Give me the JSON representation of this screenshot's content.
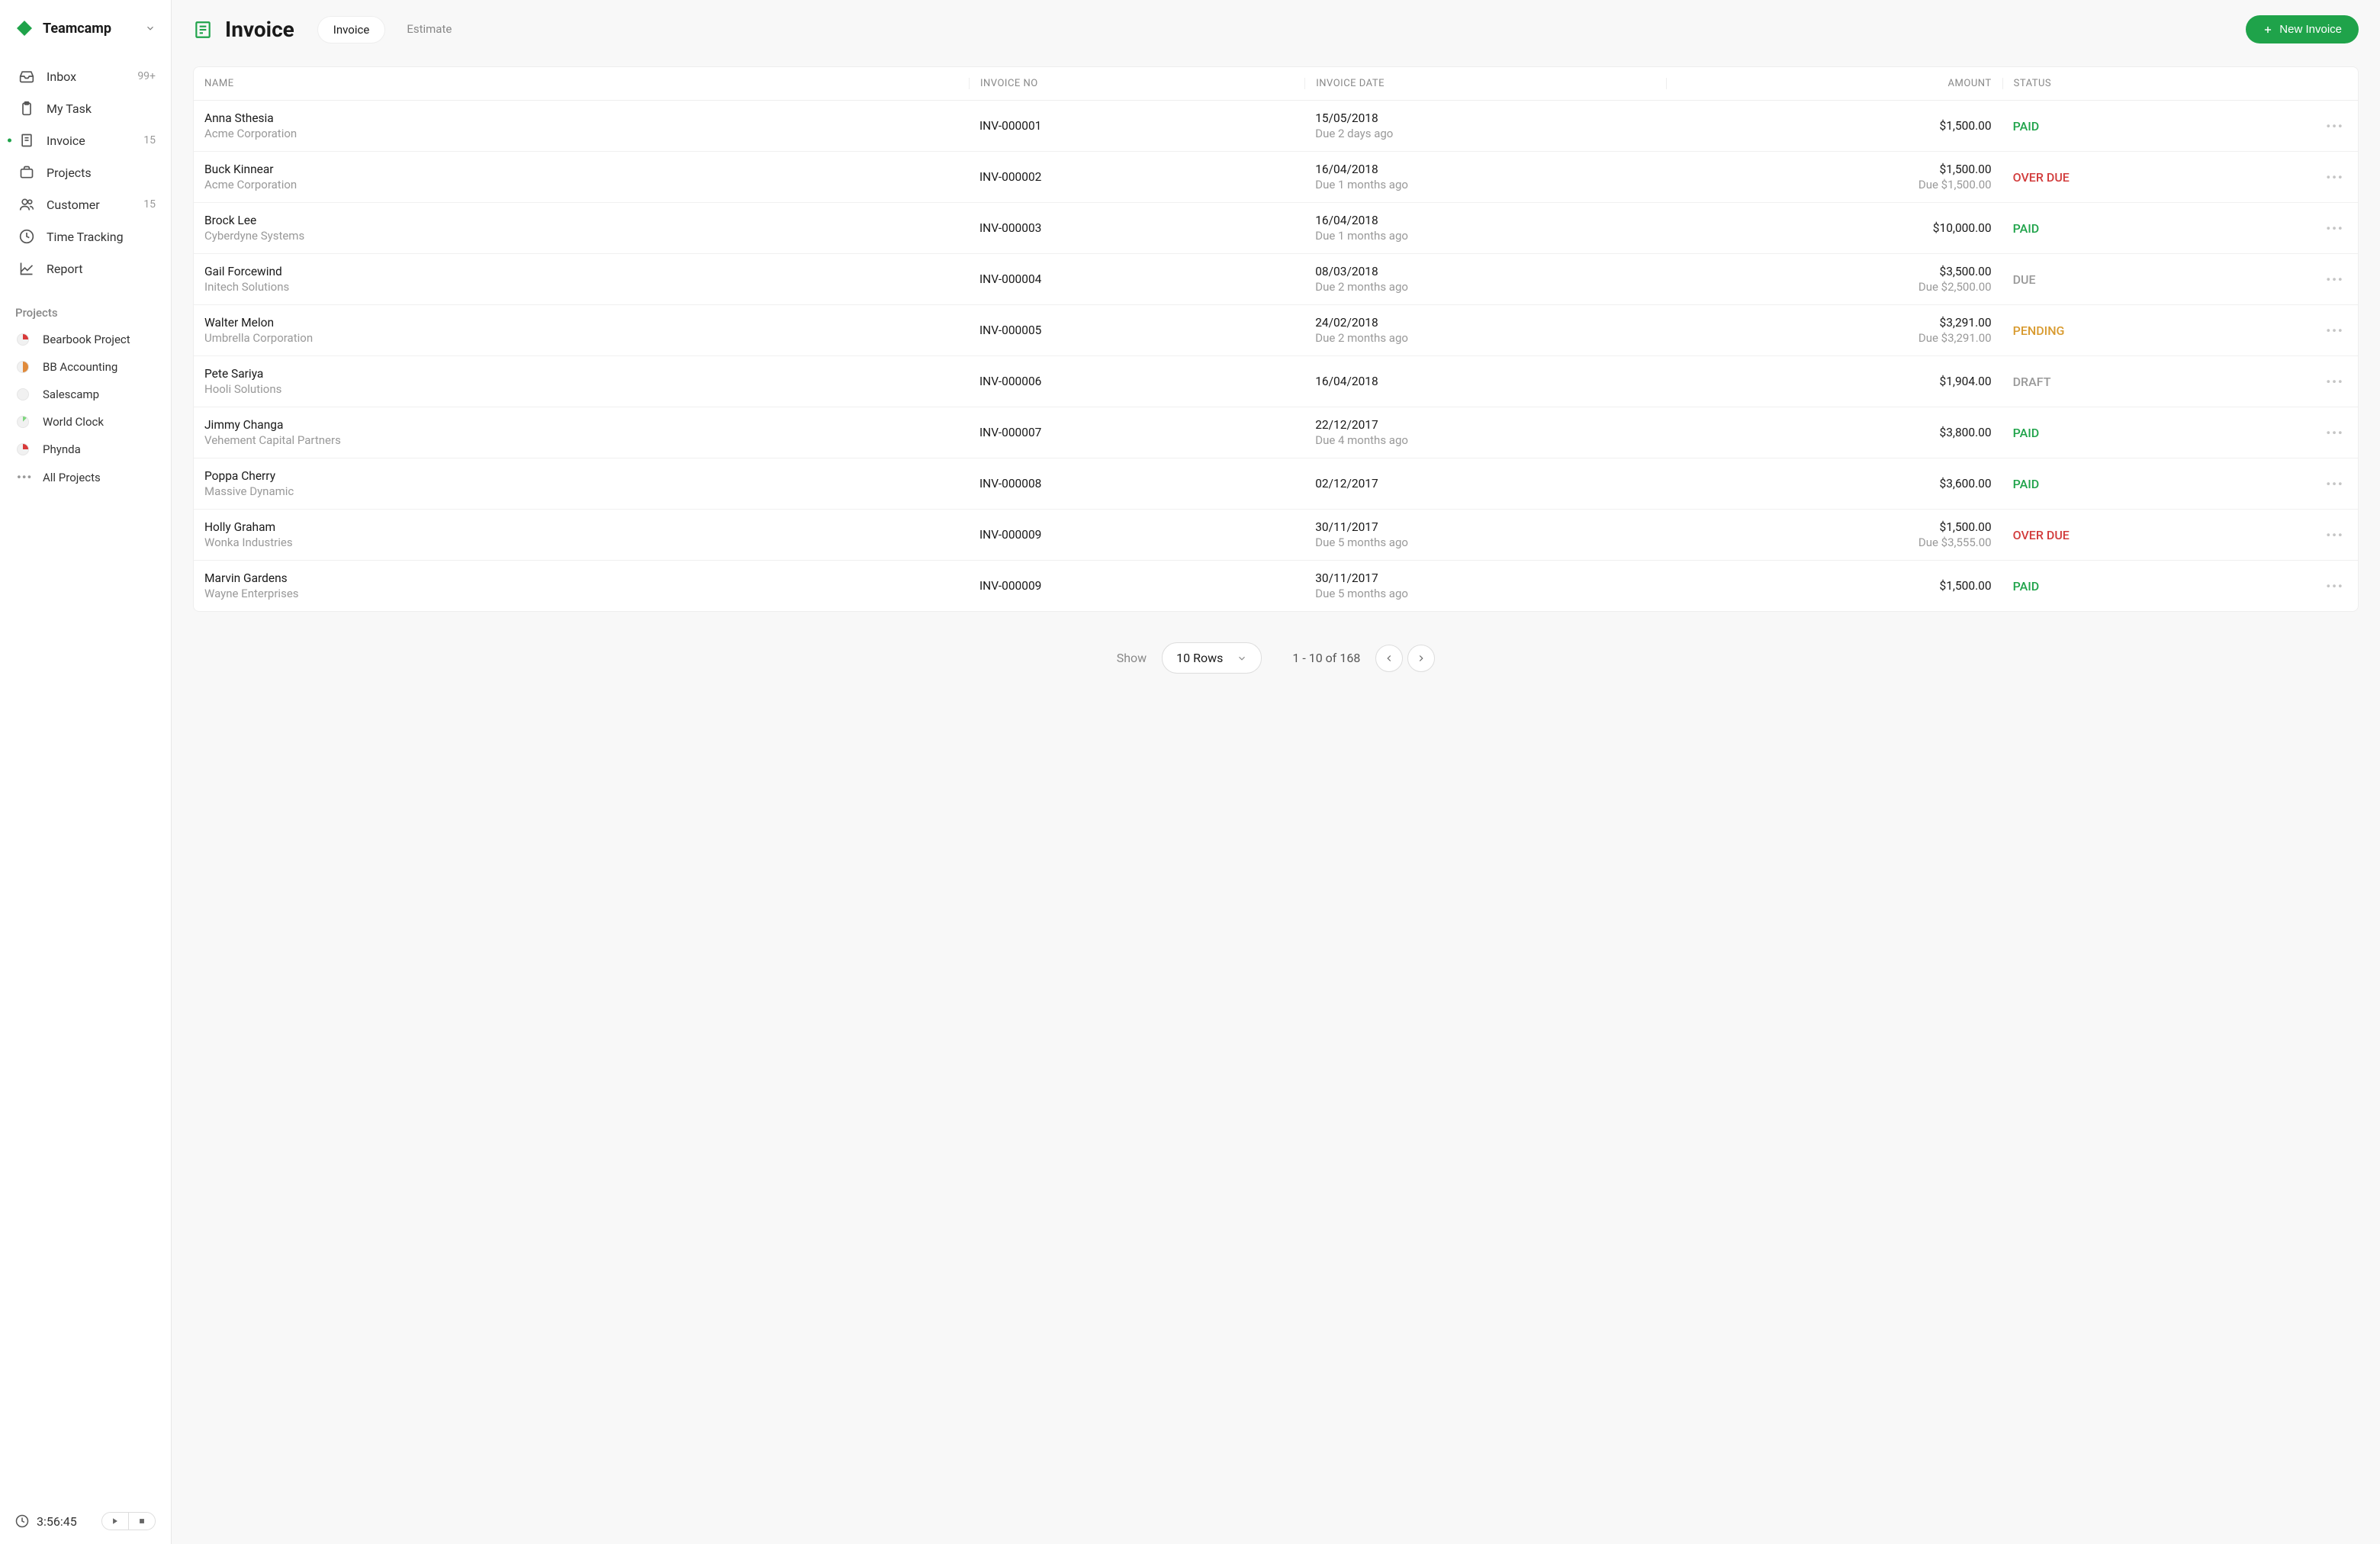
{
  "brand": {
    "name": "Teamcamp"
  },
  "nav": [
    {
      "label": "Inbox",
      "badge": "99+",
      "icon": "inbox"
    },
    {
      "label": "My Task",
      "badge": "",
      "icon": "clipboard"
    },
    {
      "label": "Invoice",
      "badge": "15",
      "icon": "file",
      "active": true
    },
    {
      "label": "Projects",
      "badge": "",
      "icon": "briefcase"
    },
    {
      "label": "Customer",
      "badge": "15",
      "icon": "users"
    },
    {
      "label": "Time Tracking",
      "badge": "",
      "icon": "clock"
    },
    {
      "label": "Report",
      "badge": "",
      "icon": "chart"
    }
  ],
  "projects_section": "Projects",
  "projects": [
    {
      "label": "Bearbook Project",
      "color": "#d83a3a",
      "pct": 25
    },
    {
      "label": "BB Accounting",
      "color": "#e08a3a",
      "pct": 50
    },
    {
      "label": "Salescamp",
      "color": "#dedede",
      "pct": 0
    },
    {
      "label": "World Clock",
      "color": "#7ed67e",
      "pct": 12
    },
    {
      "label": "Phynda",
      "color": "#d83a3a",
      "pct": 25
    }
  ],
  "all_projects": "All Projects",
  "timer": {
    "value": "3:56:45"
  },
  "page": {
    "title": "Invoice"
  },
  "tabs": [
    {
      "label": "Invoice",
      "active": true
    },
    {
      "label": "Estimate",
      "active": false
    }
  ],
  "new_button": "New Invoice",
  "columns": {
    "name": "NAME",
    "no": "INVOICE NO",
    "date": "INVOICE DATE",
    "amount": "AMOUNT",
    "status": "STATUS"
  },
  "rows": [
    {
      "name": "Anna Sthesia",
      "company": "Acme Corporation",
      "no": "INV-000001",
      "date": "15/05/2018",
      "due": "Due 2 days ago",
      "amount": "$1,500.00",
      "amount_sub": "",
      "status": "PAID"
    },
    {
      "name": "Buck Kinnear",
      "company": "Acme Corporation",
      "no": "INV-000002",
      "date": "16/04/2018",
      "due": "Due 1 months ago",
      "amount": "$1,500.00",
      "amount_sub": "Due $1,500.00",
      "status": "OVER DUE"
    },
    {
      "name": "Brock Lee",
      "company": "Cyberdyne Systems",
      "no": "INV-000003",
      "date": "16/04/2018",
      "due": "Due 1 months ago",
      "amount": "$10,000.00",
      "amount_sub": "",
      "status": "PAID"
    },
    {
      "name": "Gail Forcewind",
      "company": "Initech Solutions",
      "no": "INV-000004",
      "date": "08/03/2018",
      "due": "Due 2 months ago",
      "amount": "$3,500.00",
      "amount_sub": "Due $2,500.00",
      "status": "DUE"
    },
    {
      "name": "Walter Melon",
      "company": "Umbrella Corporation",
      "no": "INV-000005",
      "date": "24/02/2018",
      "due": "Due 2 months ago",
      "amount": "$3,291.00",
      "amount_sub": "Due $3,291.00",
      "status": "PENDING"
    },
    {
      "name": "Pete Sariya",
      "company": "Hooli Solutions",
      "no": "INV-000006",
      "date": "16/04/2018",
      "due": "",
      "amount": "$1,904.00",
      "amount_sub": "",
      "status": "DRAFT"
    },
    {
      "name": "Jimmy Changa",
      "company": "Vehement Capital Partners",
      "no": "INV-000007",
      "date": "22/12/2017",
      "due": "Due 4 months ago",
      "amount": "$3,800.00",
      "amount_sub": "",
      "status": "PAID"
    },
    {
      "name": "Poppa Cherry",
      "company": "Massive Dynamic",
      "no": "INV-000008",
      "date": "02/12/2017",
      "due": "",
      "amount": "$3,600.00",
      "amount_sub": "",
      "status": "PAID"
    },
    {
      "name": "Holly Graham",
      "company": "Wonka Industries",
      "no": "INV-000009",
      "date": "30/11/2017",
      "due": "Due 5 months ago",
      "amount": "$1,500.00",
      "amount_sub": "Due $3,555.00",
      "status": "OVER DUE"
    },
    {
      "name": "Marvin Gardens",
      "company": "Wayne Enterprises",
      "no": "INV-000009",
      "date": "30/11/2017",
      "due": "Due 5 months ago",
      "amount": "$1,500.00",
      "amount_sub": "",
      "status": "PAID"
    }
  ],
  "pagination": {
    "show_label": "Show",
    "rows_label": "10 Rows",
    "info": "1 - 10 of 168"
  }
}
